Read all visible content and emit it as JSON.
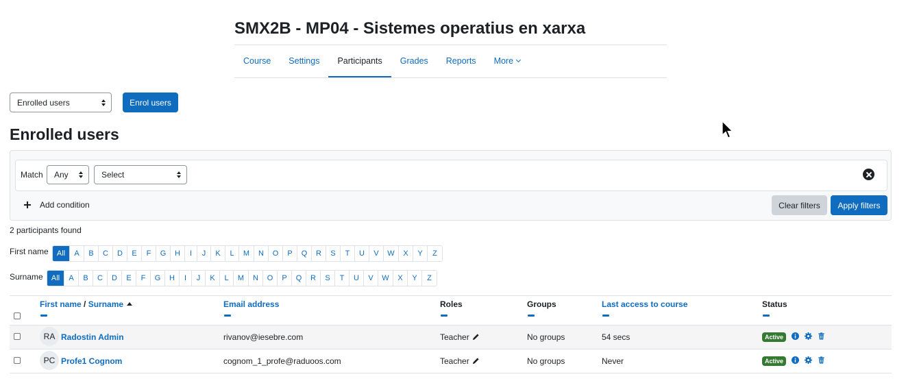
{
  "course": {
    "title": "SMX2B - MP04 - Sistemes operatius en xarxa"
  },
  "secondary_nav": {
    "tabs": [
      {
        "label": "Course"
      },
      {
        "label": "Settings"
      },
      {
        "label": "Participants",
        "active": true
      },
      {
        "label": "Grades"
      },
      {
        "label": "Reports"
      },
      {
        "label": "More"
      }
    ]
  },
  "toolbar": {
    "view_select": "Enrolled users",
    "enrol_button": "Enrol users"
  },
  "page_heading": "Enrolled users",
  "filters": {
    "match_label": "Match",
    "match_value": "Any",
    "type_value": "Select",
    "add_condition": "Add condition",
    "clear_button": "Clear filters",
    "apply_button": "Apply filters"
  },
  "participants_found": "2 participants found",
  "initials": {
    "first_name_label": "First name",
    "surname_label": "Surname",
    "all_label": "All",
    "letters": [
      "A",
      "B",
      "C",
      "D",
      "E",
      "F",
      "G",
      "H",
      "I",
      "J",
      "K",
      "L",
      "M",
      "N",
      "O",
      "P",
      "Q",
      "R",
      "S",
      "T",
      "U",
      "V",
      "W",
      "X",
      "Y",
      "Z"
    ]
  },
  "table": {
    "headers": {
      "first_name": "First name",
      "separator": " / ",
      "surname": "Surname",
      "email": "Email address",
      "roles": "Roles",
      "groups": "Groups",
      "last_access": "Last access to course",
      "status": "Status"
    },
    "rows": [
      {
        "initials": "RA",
        "name": "Radostin Admin",
        "email": "rivanov@iesebre.com",
        "role": "Teacher",
        "groups": "No groups",
        "last_access": "54 secs",
        "status": "Active"
      },
      {
        "initials": "PC",
        "name": "Profe1 Cognom",
        "email": "cognom_1_profe@raduoos.com",
        "role": "Teacher",
        "groups": "No groups",
        "last_access": "Never",
        "status": "Active"
      }
    ]
  },
  "colors": {
    "primary": "#0f6cbf",
    "active_badge": "#357a32",
    "secondary_button": "#ced4da"
  }
}
